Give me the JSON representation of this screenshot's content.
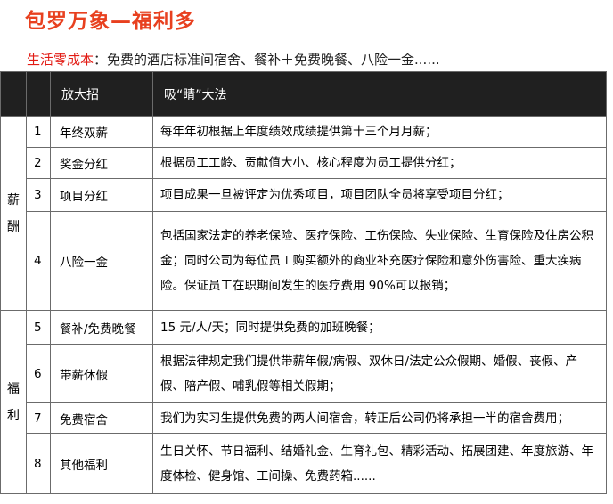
{
  "title": "包罗万象—福利多",
  "subtitle": {
    "label": "生活零成本",
    "text": "：免费的酒店标准间宿舍、餐补＋免费晚餐、八险一金......"
  },
  "table": {
    "headers": [
      "",
      "",
      "放大招",
      "吸“睛”大法"
    ],
    "categories": [
      {
        "chars": [
          "薪",
          "酬"
        ]
      },
      {
        "chars": [
          "福",
          "利"
        ]
      }
    ],
    "rows": [
      {
        "num": "1",
        "name": "年终双薪",
        "desc": "每年年初根据上年度绩效成绩提供第十三个月月薪；"
      },
      {
        "num": "2",
        "name": "奖金分红",
        "desc": "根据员工工龄、贡献值大小、核心程度为员工提供分红；"
      },
      {
        "num": "3",
        "name": "项目分红",
        "desc": "项目成果一旦被评定为优秀项目，项目团队全员将享受项目分红；"
      },
      {
        "num": "4",
        "name": "八险一金",
        "desc": "包括国家法定的养老保险、医疗保险、工伤保险、失业保险、生育保险及住房公积金；同时公司为每位员工购买额外的商业补充医疗保险和意外伤害险、重大疾病险。保证员工在职期间发生的医疗费用 90%可以报销；"
      },
      {
        "num": "5",
        "name": "餐补/免费晚餐",
        "desc": "15 元/人/天；同时提供免费的加班晚餐；"
      },
      {
        "num": "6",
        "name": "带薪休假",
        "desc": "根据法律规定我们提供带薪年假/病假、双休日/法定公众假期、婚假、丧假、产假、陪产假、哺乳假等相关假期；"
      },
      {
        "num": "7",
        "name": "免费宿舍",
        "desc": "我们为实习生提供免费的两人间宿舍，转正后公司仍将承担一半的宿舍费用；"
      },
      {
        "num": "8",
        "name": "其他福利",
        "desc": "生日关怀、节日福利、结婚礼金、生育礼包、精彩活动、拓展团建、年度旅游、年度体检、健身馆、工间操、免费药箱......"
      }
    ]
  }
}
